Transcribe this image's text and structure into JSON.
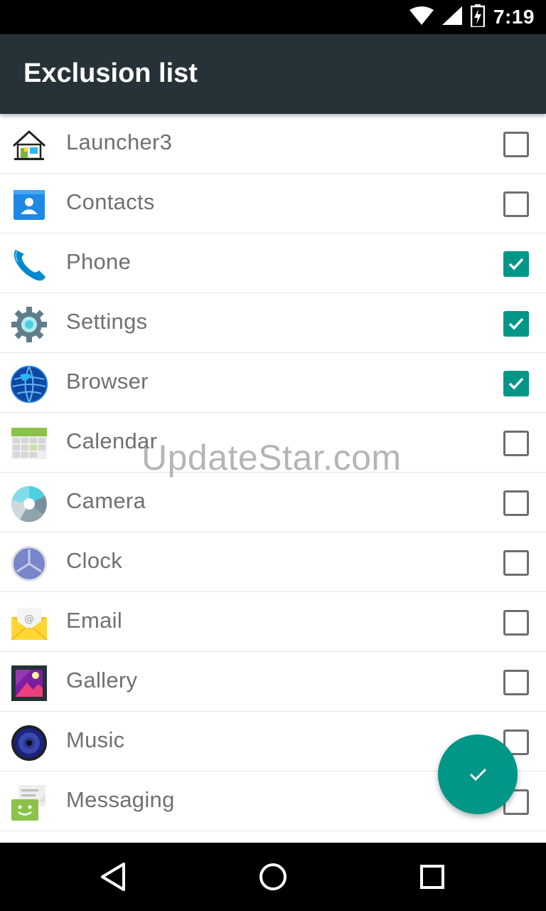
{
  "status_bar": {
    "time": "7:19"
  },
  "app_bar": {
    "title": "Exclusion list"
  },
  "apps": [
    {
      "name": "Launcher3",
      "icon": "launcher-home-icon",
      "checked": false
    },
    {
      "name": "Contacts",
      "icon": "contacts-icon",
      "checked": false
    },
    {
      "name": "Phone",
      "icon": "phone-icon",
      "checked": true
    },
    {
      "name": "Settings",
      "icon": "settings-gear-icon",
      "checked": true
    },
    {
      "name": "Browser",
      "icon": "browser-globe-icon",
      "checked": true
    },
    {
      "name": "Calendar",
      "icon": "calendar-icon",
      "checked": false
    },
    {
      "name": "Camera",
      "icon": "camera-icon",
      "checked": false
    },
    {
      "name": "Clock",
      "icon": "clock-icon",
      "checked": false
    },
    {
      "name": "Email",
      "icon": "email-icon",
      "checked": false
    },
    {
      "name": "Gallery",
      "icon": "gallery-icon",
      "checked": false
    },
    {
      "name": "Music",
      "icon": "music-icon",
      "checked": false
    },
    {
      "name": "Messaging",
      "icon": "messaging-icon",
      "checked": false
    }
  ],
  "watermark": "UpdateStar.com",
  "fab": {
    "icon": "check-icon"
  },
  "nav": {
    "back_icon": "back-triangle-icon",
    "home_icon": "home-circle-icon",
    "recents_icon": "recents-square-icon"
  },
  "colors": {
    "app_bar": "#263238",
    "accent": "#009688",
    "label": "#707070"
  }
}
